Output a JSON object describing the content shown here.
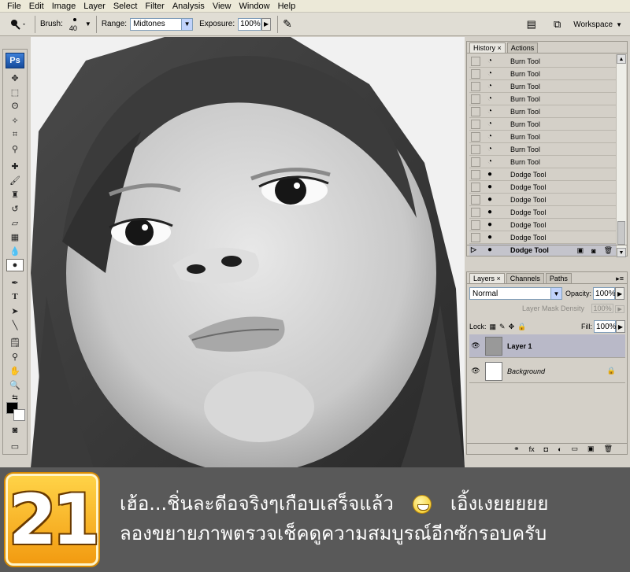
{
  "menu": [
    "File",
    "Edit",
    "Image",
    "Layer",
    "Select",
    "Filter",
    "Analysis",
    "View",
    "Window",
    "Help"
  ],
  "options": {
    "brush_label": "Brush:",
    "brush_size": "40",
    "range_label": "Range:",
    "range_value": "Midtones",
    "exposure_label": "Exposure:",
    "exposure_value": "100%",
    "workspace_label": "Workspace"
  },
  "history": {
    "tabs": [
      "History",
      "Actions"
    ],
    "items": [
      "Burn Tool",
      "Burn Tool",
      "Burn Tool",
      "Burn Tool",
      "Burn Tool",
      "Burn Tool",
      "Burn Tool",
      "Burn Tool",
      "Burn Tool",
      "Dodge Tool",
      "Dodge Tool",
      "Dodge Tool",
      "Dodge Tool",
      "Dodge Tool",
      "Dodge Tool",
      "Dodge Tool"
    ]
  },
  "layers": {
    "tabs": [
      "Layers",
      "Channels",
      "Paths"
    ],
    "blend_mode": "Normal",
    "opacity_label": "Opacity:",
    "opacity_value": "100%",
    "mask_density_label": "Layer Mask Density",
    "mask_density_value": "100%",
    "lock_label": "Lock:",
    "fill_label": "Fill:",
    "fill_value": "100%",
    "items": [
      {
        "name": "Layer 1"
      },
      {
        "name": "Background"
      }
    ]
  },
  "banner": {
    "step_number": "21",
    "line1_a": "เฮ้อ...ชิ่นละดีอจริงๆเกือบเสร็จแล้ว",
    "line1_b": "เอิ้งเงยยยยย",
    "line2": "ลองขยายภาพตรวจเช็คดูความสมบูรณ์อีกซักรอบครับ"
  }
}
